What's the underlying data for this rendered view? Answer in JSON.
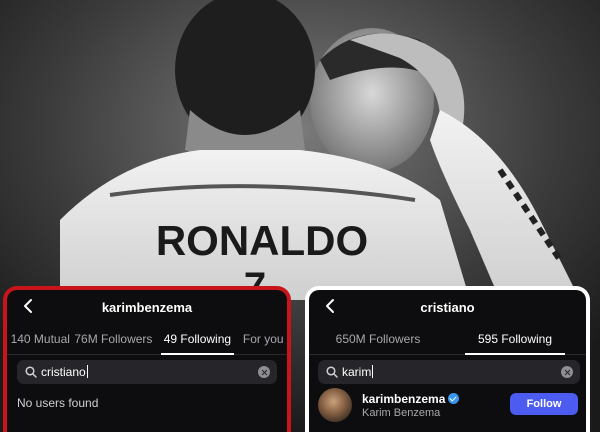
{
  "left_panel": {
    "title": "karimbenzema",
    "tabs": [
      {
        "label": "140 Mutual"
      },
      {
        "label": "76M Followers"
      },
      {
        "label": "49 Following"
      },
      {
        "label": "For you"
      }
    ],
    "active_tab": "49 Following",
    "search_value": "cristiano",
    "empty_message": "No users found"
  },
  "right_panel": {
    "title": "cristiano",
    "tabs": [
      {
        "label": "650M Followers"
      },
      {
        "label": "595 Following"
      }
    ],
    "active_tab": "595 Following",
    "search_value": "karim",
    "result": {
      "username": "karimbenzema",
      "full_name": "Karim Benzema",
      "verified": true,
      "button_label": "Follow"
    }
  },
  "background": {
    "jersey_text": "RONALDO",
    "jersey_number": "7"
  },
  "colors": {
    "left_border": "#c8141b",
    "right_border": "#ffffff",
    "follow_button": "#4c5cf0",
    "verified_badge": "#3897f0"
  }
}
